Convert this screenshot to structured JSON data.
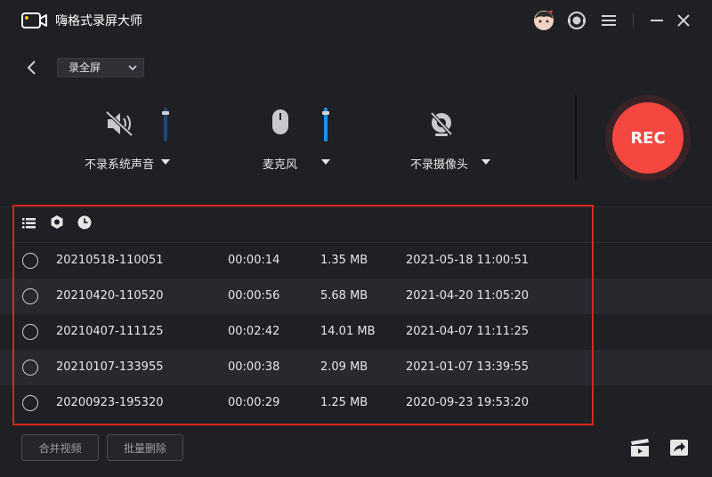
{
  "app": {
    "title": "嗨格式录屏大师"
  },
  "titlebar": {
    "icons": [
      "avatar-icon",
      "support-icon",
      "menu-icon",
      "minimize-icon",
      "close-icon"
    ]
  },
  "record": {
    "mode_select": "录全屏",
    "system_audio_label": "不录系统声音",
    "microphone_label": "麦克风",
    "camera_label": "不录摄像头",
    "rec_button": "REC"
  },
  "list": {
    "toolbar_icons": [
      "list-icon",
      "settings-icon",
      "clock-icon"
    ],
    "rows": [
      {
        "name": "20210518-110051",
        "duration": "00:00:14",
        "size": "1.35 MB",
        "date": "2021-05-18 11:00:51"
      },
      {
        "name": "20210420-110520",
        "duration": "00:00:56",
        "size": "5.68 MB",
        "date": "2021-04-20 11:05:20"
      },
      {
        "name": "20210407-111125",
        "duration": "00:02:42",
        "size": "14.01 MB",
        "date": "2021-04-07 11:11:25"
      },
      {
        "name": "20210107-133955",
        "duration": "00:00:38",
        "size": "2.09 MB",
        "date": "2021-01-07 13:39:55"
      },
      {
        "name": "20200923-195320",
        "duration": "00:00:29",
        "size": "1.25 MB",
        "date": "2020-09-23 19:53:20"
      }
    ]
  },
  "bottom": {
    "merge_label": "合并视频",
    "batch_delete_label": "批量删除"
  },
  "colors": {
    "accent": "#f5473f",
    "highlight_border": "#e0231c",
    "slider_active": "#1e90ff",
    "slider_inactive": "#1c4a75"
  }
}
